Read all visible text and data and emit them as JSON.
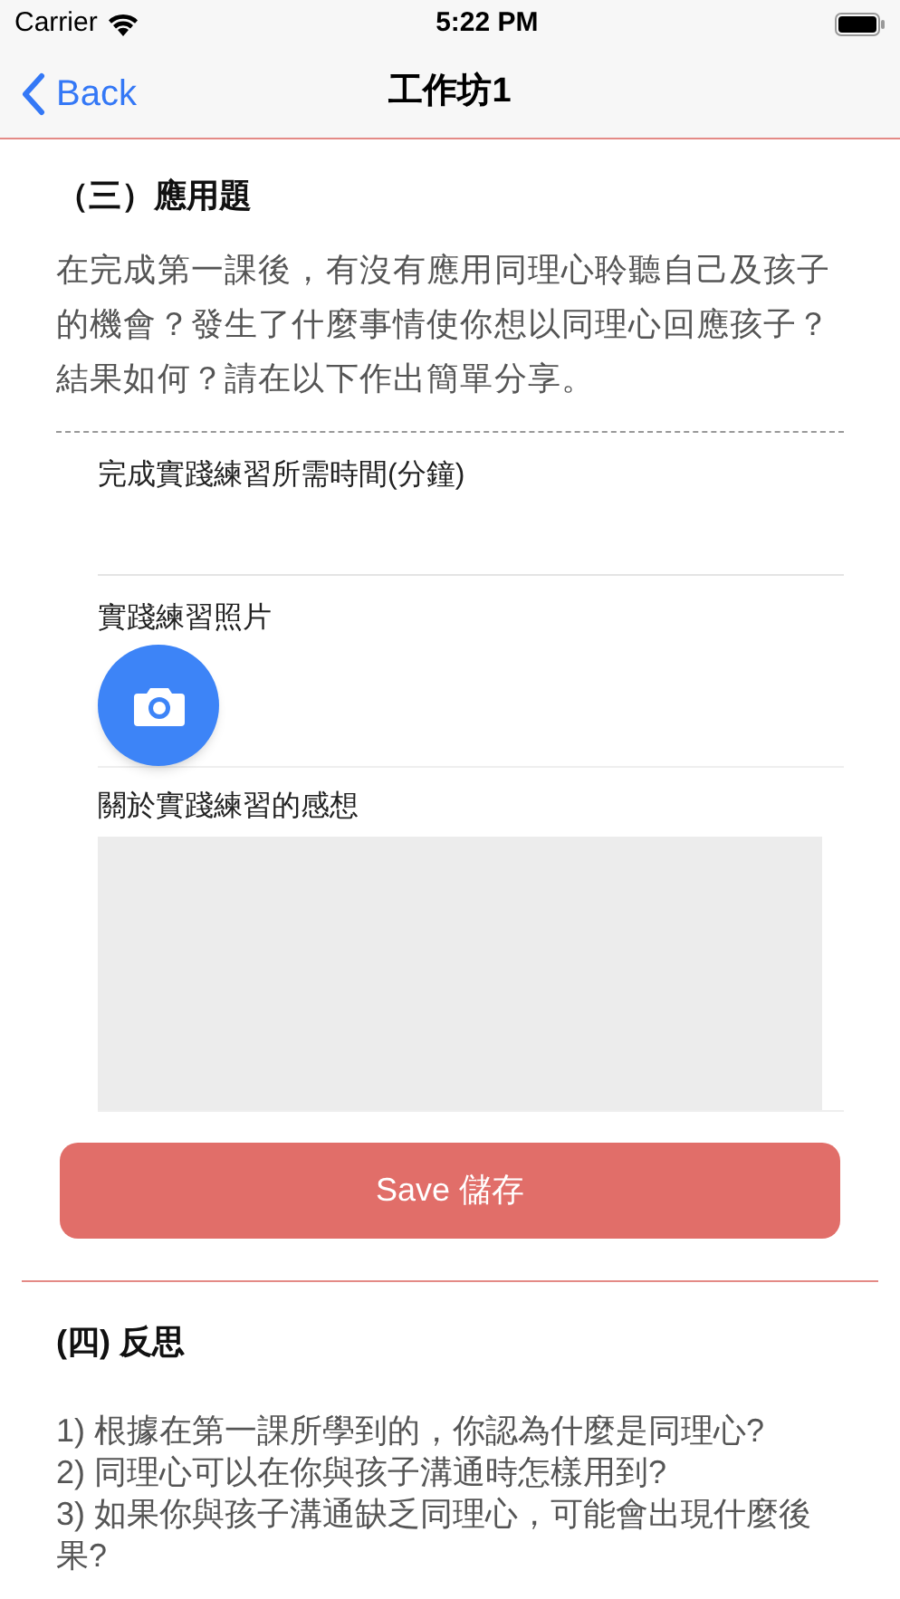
{
  "status_bar": {
    "carrier": "Carrier",
    "time": "5:22 PM"
  },
  "nav": {
    "back": "Back",
    "title": "工作坊1"
  },
  "section_3": {
    "heading": "（三）應用題",
    "question": "在完成第一課後，有沒有應用同理心聆聽自己及孩子的機會？發生了什麼事情使你想以同理心回應孩子？結果如何？請在以下作出簡單分享。",
    "fields": [
      {
        "kind": "text",
        "label": "完成實踐練習所需時間(分鐘)"
      },
      {
        "kind": "photo",
        "label": "實踐練習照片"
      },
      {
        "kind": "textarea",
        "label": "關於實踐練習的感想"
      }
    ],
    "save_button": "Save 儲存"
  },
  "section_4": {
    "heading": "(四) 反思",
    "questions": [
      "1) 根據在第一課所學到的，你認為什麼是同理心?",
      "2) 同理心可以在你與孩子溝通時怎樣用到?",
      "3) 如果你與孩子溝通缺乏同理心，可能會出現什麼後果?"
    ]
  }
}
